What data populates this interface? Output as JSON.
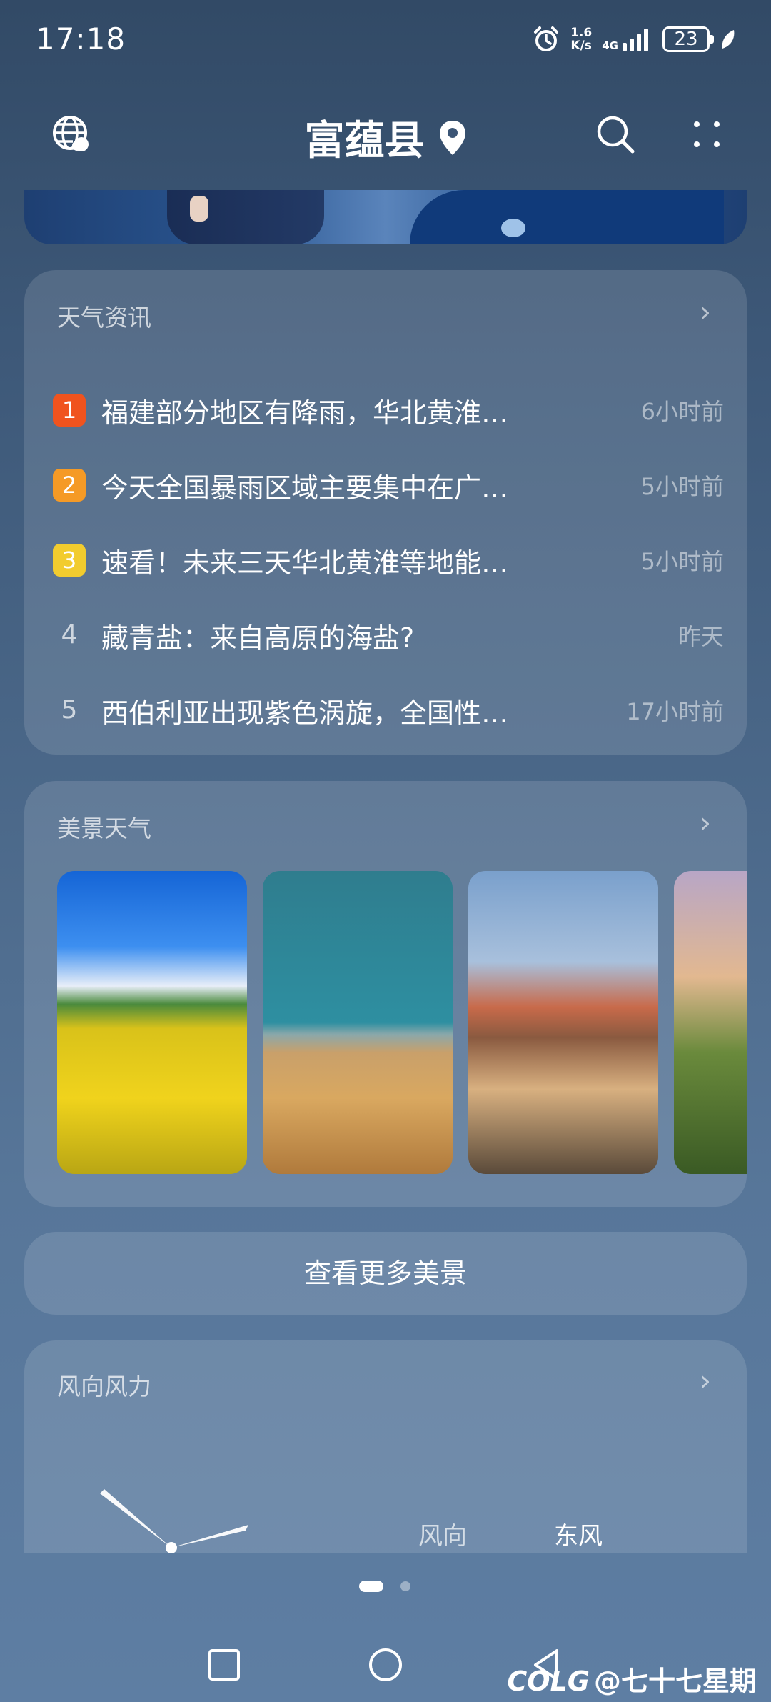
{
  "status_bar": {
    "time": "17:18",
    "net_speed_value": "1.6",
    "net_speed_unit": "K/s",
    "net_type": "4G",
    "battery": "23"
  },
  "header": {
    "city": "富蕴县"
  },
  "news": {
    "title": "天气资讯",
    "items": [
      {
        "rank": "1",
        "title": "福建部分地区有降雨，华北黄淮…",
        "time": "6小时前",
        "color": "#f0531e"
      },
      {
        "rank": "2",
        "title": "今天全国暴雨区域主要集中在广…",
        "time": "5小时前",
        "color": "#f59a26"
      },
      {
        "rank": "3",
        "title": "速看！未来三天华北黄淮等地能…",
        "time": "5小时前",
        "color": "#f2cc2e"
      },
      {
        "rank": "4",
        "title": "藏青盐：来自高原的海盐?",
        "time": "昨天",
        "color": ""
      },
      {
        "rank": "5",
        "title": "西伯利亚出现紫色涡旋，全国性…",
        "time": "17小时前",
        "color": ""
      }
    ]
  },
  "scenery": {
    "title": "美景天气",
    "more_label": "查看更多美景"
  },
  "wind": {
    "title": "风向风力",
    "direction_label": "风向",
    "direction_value": "东风"
  },
  "watermark": "@七十七星期",
  "watermark_logo": "COLG"
}
